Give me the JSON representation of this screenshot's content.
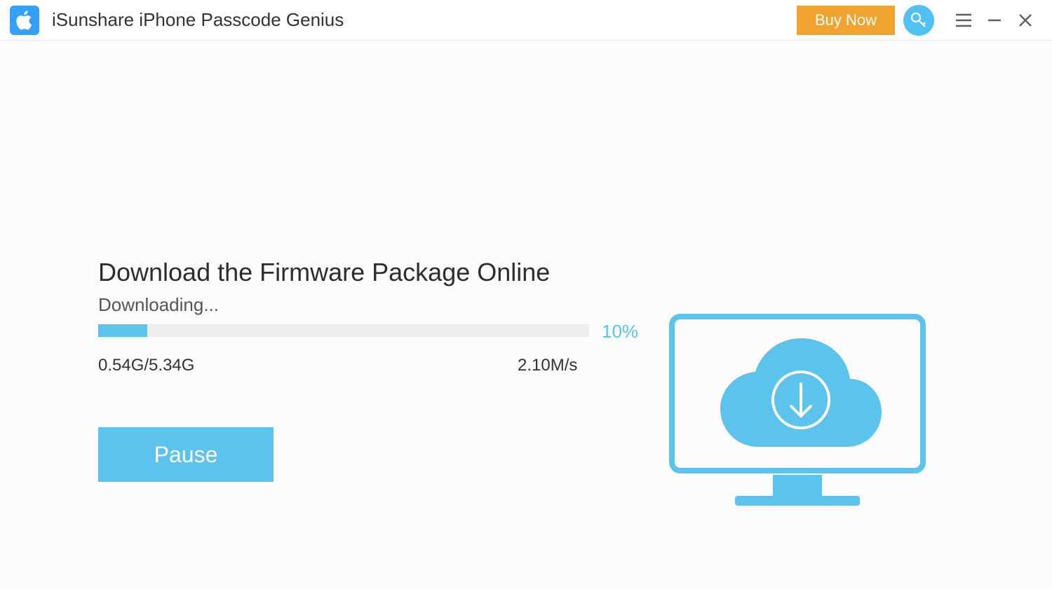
{
  "titlebar": {
    "app_title": "iSunshare iPhone Passcode Genius",
    "buy_now": "Buy Now"
  },
  "main": {
    "heading": "Download the Firmware Package Online",
    "status": "Downloading...",
    "progress_percent": 10,
    "progress_label": "10%",
    "size_text": "0.54G/5.34G",
    "speed_text": "2.10M/s",
    "pause_label": "Pause"
  },
  "colors": {
    "accent": "#5cc3ec",
    "buy": "#f0a32f",
    "logo": "#34a0f7"
  }
}
